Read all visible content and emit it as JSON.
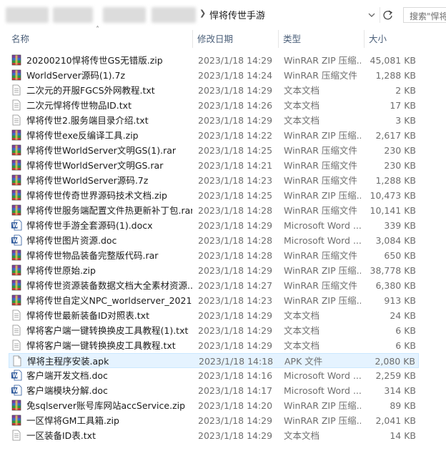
{
  "address": {
    "path_label": "悍将传世手游",
    "search_placeholder": "搜索\"悍将"
  },
  "columns": {
    "name": "名称",
    "date": "修改日期",
    "type": "类型",
    "size": "大小"
  },
  "files": [
    {
      "name": "20200210悍将传世GS无错版.zip",
      "date": "2023/1/18 14:29",
      "type": "WinRAR ZIP 压缩...",
      "size": "45,081 KB",
      "icon": "winrar"
    },
    {
      "name": "WorldServer源码(1).7z",
      "date": "2023/1/18 14:24",
      "type": "WinRAR 压缩文件",
      "size": "1,288 KB",
      "icon": "winrar"
    },
    {
      "name": "二次元的开服FGCS外网教程.txt",
      "date": "2023/1/18 14:29",
      "type": "文本文档",
      "size": "2 KB",
      "icon": "txt"
    },
    {
      "name": "二次元悍将传世物品ID.txt",
      "date": "2023/1/18 14:26",
      "type": "文本文档",
      "size": "17 KB",
      "icon": "txt"
    },
    {
      "name": "悍将传世2.服务端目录介绍.txt",
      "date": "2023/1/18 14:29",
      "type": "文本文档",
      "size": "3 KB",
      "icon": "txt"
    },
    {
      "name": "悍将传世exe反编译工具.zip",
      "date": "2023/1/18 14:22",
      "type": "WinRAR ZIP 压缩...",
      "size": "2,617 KB",
      "icon": "winrar"
    },
    {
      "name": "悍将传世WorldServer文明GS(1).rar",
      "date": "2023/1/18 14:25",
      "type": "WinRAR 压缩文件",
      "size": "230 KB",
      "icon": "winrar"
    },
    {
      "name": "悍将传世WorldServer文明GS.rar",
      "date": "2023/1/18 14:21",
      "type": "WinRAR 压缩文件",
      "size": "230 KB",
      "icon": "winrar"
    },
    {
      "name": "悍将传世WorldServer源码.7z",
      "date": "2023/1/18 14:23",
      "type": "WinRAR 压缩文件",
      "size": "1,288 KB",
      "icon": "winrar"
    },
    {
      "name": "悍将传世传奇世界源码技术文档.zip",
      "date": "2023/1/18 14:25",
      "type": "WinRAR ZIP 压缩...",
      "size": "10,473 KB",
      "icon": "winrar"
    },
    {
      "name": "悍将传世服务端配置文件热更新补丁包.rar",
      "date": "2023/1/18 14:28",
      "type": "WinRAR 压缩文件",
      "size": "10,141 KB",
      "icon": "winrar"
    },
    {
      "name": "悍将传世手游全套源码(1).docx",
      "date": "2023/1/18 14:29",
      "type": "Microsoft Word ...",
      "size": "339 KB",
      "icon": "word"
    },
    {
      "name": "悍将传世图片资源.doc",
      "date": "2023/1/18 14:28",
      "type": "Microsoft Word ...",
      "size": "3,084 KB",
      "icon": "word"
    },
    {
      "name": "悍将传世物品装备完整版代码.rar",
      "date": "2023/1/18 14:28",
      "type": "WinRAR 压缩文件",
      "size": "650 KB",
      "icon": "winrar"
    },
    {
      "name": "悍将传世原始.zip",
      "date": "2023/1/18 14:29",
      "type": "WinRAR ZIP 压缩...",
      "size": "38,778 KB",
      "icon": "winrar"
    },
    {
      "name": "悍将传世资源装备数据文档大全素材资源...",
      "date": "2023/1/18 14:27",
      "type": "WinRAR 压缩文件",
      "size": "6,380 KB",
      "icon": "winrar"
    },
    {
      "name": "悍将传世自定义NPC_worldserver_2021...",
      "date": "2023/1/18 14:23",
      "type": "WinRAR ZIP 压缩...",
      "size": "913 KB",
      "icon": "winrar"
    },
    {
      "name": "悍将传世最新装备ID对照表.txt",
      "date": "2023/1/18 14:29",
      "type": "文本文档",
      "size": "24 KB",
      "icon": "txt"
    },
    {
      "name": "悍将客户端一键转换换皮工具教程(1).txt",
      "date": "2023/1/18 14:29",
      "type": "文本文档",
      "size": "6 KB",
      "icon": "txt"
    },
    {
      "name": "悍将客户端一键转换换皮工具教程.txt",
      "date": "2023/1/18 14:29",
      "type": "文本文档",
      "size": "6 KB",
      "icon": "txt"
    },
    {
      "name": "悍将主程序安装.apk",
      "date": "2023/1/18 14:18",
      "type": "APK 文件",
      "size": "2,080 KB",
      "icon": "blank",
      "selected": true
    },
    {
      "name": "客户端开发文档.doc",
      "date": "2023/1/18 14:16",
      "type": "Microsoft Word ...",
      "size": "2,259 KB",
      "icon": "word"
    },
    {
      "name": "客户端模块分解.doc",
      "date": "2023/1/18 14:17",
      "type": "Microsoft Word ...",
      "size": "314 KB",
      "icon": "word"
    },
    {
      "name": "免sqlserver账号库网站accService.zip",
      "date": "2023/1/18 14:20",
      "type": "WinRAR ZIP 压缩...",
      "size": "89 KB",
      "icon": "winrar"
    },
    {
      "name": "一区悍将GM工具箱.zip",
      "date": "2023/1/18 14:29",
      "type": "WinRAR ZIP 压缩...",
      "size": "2,041 KB",
      "icon": "winrar"
    },
    {
      "name": "一区装备ID表.txt",
      "date": "2023/1/18 14:29",
      "type": "文本文档",
      "size": "14 KB",
      "icon": "txt"
    }
  ]
}
